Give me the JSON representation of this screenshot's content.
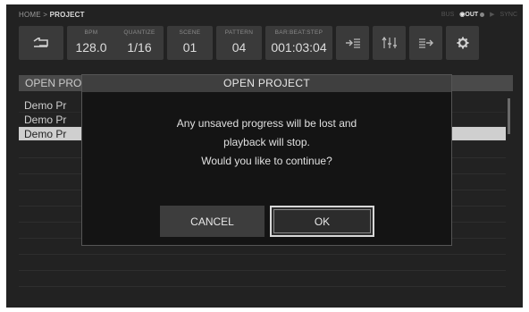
{
  "breadcrumb": {
    "home": "HOME",
    "sep": ">",
    "current": "PROJECT"
  },
  "status": {
    "left": "BUS",
    "out": "OUT",
    "dim1": "",
    "dim2": "SYNC"
  },
  "topbar": {
    "bpm_label": "BPM",
    "bpm_value": "128.0",
    "quantize_label": "QUANTIZE",
    "quantize_value": "1/16",
    "scene_label": "SCENE",
    "scene_value": "01",
    "pattern_label": "PATTERN",
    "pattern_value": "04",
    "position_label": "BAR:BEAT:STEP",
    "position_value": "001:03:04",
    "icons": [
      "return-arrow-icon",
      "import-icon",
      "mixer-icon",
      "export-icon",
      "gear-icon"
    ]
  },
  "list": {
    "header": "OPEN PROJECT",
    "items": [
      {
        "label": "Demo Pr"
      },
      {
        "label": "Demo Pr"
      },
      {
        "label": "Demo Pr"
      }
    ],
    "selected_index": 2
  },
  "dialog": {
    "title": "OPEN PROJECT",
    "line1": "Any unsaved progress will be lost and",
    "line2": "playback will stop.",
    "line3": "Would you like to continue?",
    "cancel_label": "CANCEL",
    "ok_label": "OK"
  }
}
